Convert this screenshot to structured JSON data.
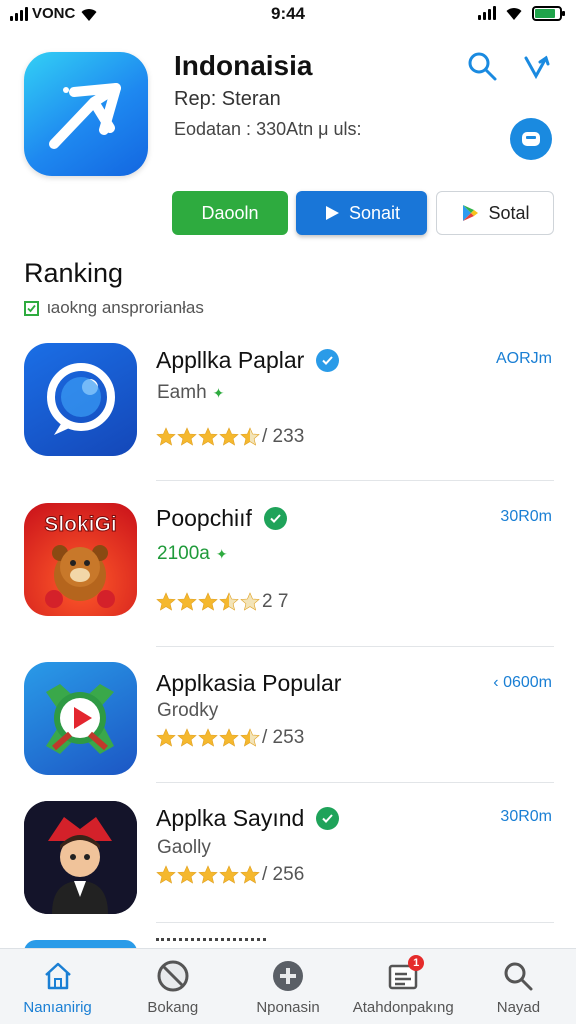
{
  "status_bar": {
    "carrier": "VONC",
    "time": "9:44"
  },
  "header": {
    "title": "Indonaisia",
    "developer": "Rep: Steran",
    "meta": "Eodatan : 330Atn μ uls:",
    "buttons": {
      "primary": "Daooln",
      "secondary": "Sonait",
      "tertiary": "Sotal"
    }
  },
  "section": {
    "title": "Ranking",
    "subtitle": "ιaokng ansprorianłas"
  },
  "apps": [
    {
      "name": "Appllka Paplar",
      "category": "Eamh",
      "rating_text": "/ 233",
      "stars": 4.5,
      "size": "AORJm",
      "verified_color": "#2a9be8",
      "category_green": false
    },
    {
      "name": "Poopchiıf",
      "category": "2100a",
      "rating_text": "2 7",
      "stars": 3.5,
      "size": "30R0m",
      "verified_color": "#1fa35a",
      "category_green": true,
      "icon_text": "SlokiGi"
    },
    {
      "name": "Applkasia Popular",
      "category": "Grodky",
      "rating_text": "/ 253",
      "stars": 4.5,
      "size": "‹ 0600m",
      "verified_color": "",
      "category_green": false
    },
    {
      "name": "Applka Sayınd",
      "category": "Gaolly",
      "rating_text": "/ 256",
      "stars": 5,
      "size": "30R0m",
      "verified_color": "#1fa35a",
      "category_green": false
    }
  ],
  "tabs": [
    {
      "label": "Nanıanirig",
      "icon": "home-icon",
      "active": true
    },
    {
      "label": "Bokang",
      "icon": "block-icon",
      "active": false
    },
    {
      "label": "Nponasin",
      "icon": "plus-icon",
      "active": false
    },
    {
      "label": "Atahdonpakıng",
      "icon": "inbox-icon",
      "active": false,
      "badge": "1"
    },
    {
      "label": "Nayad",
      "icon": "search-icon",
      "active": false
    }
  ],
  "colors": {
    "accent": "#1a7fd4",
    "green": "#2eab3f",
    "badge": "#e52b2b"
  }
}
